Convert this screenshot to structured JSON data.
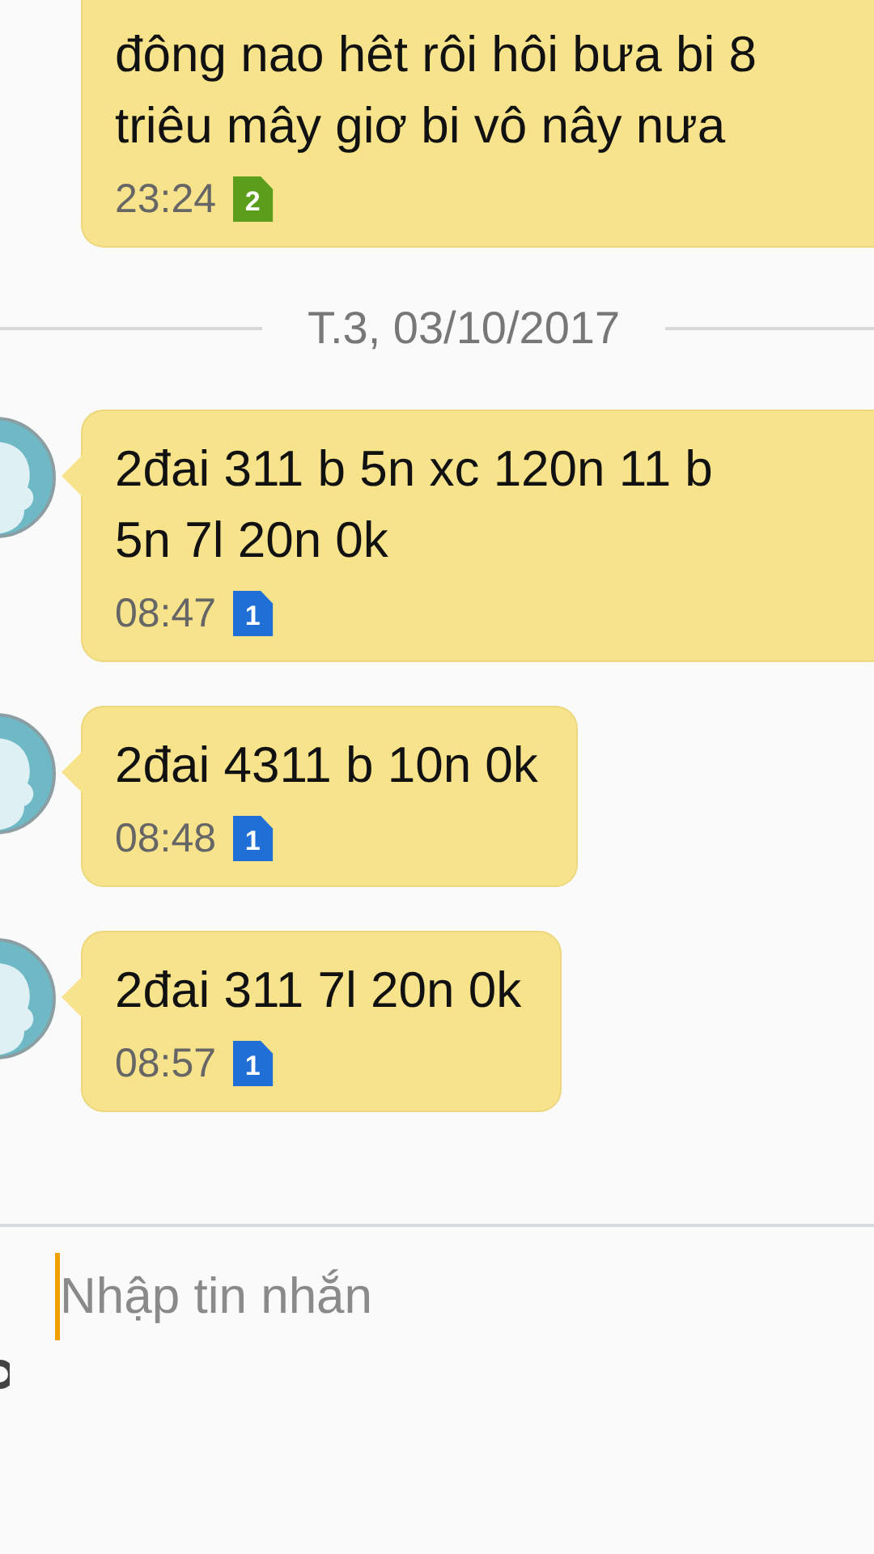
{
  "messages": [
    {
      "text": "đông nao hêt rôi hôi bưa bi 8\ntriêu mây giơ bi vô nây nưa",
      "time": "23:24",
      "sim": "2",
      "color": "#5a9e1c",
      "avatar": false,
      "cut_top": true
    },
    {
      "kind": "date",
      "text": "T.3, 03/10/2017"
    },
    {
      "text": "2đai 311 b 5n xc 120n 11 b\n5n 7l 20n 0k",
      "time": "08:47",
      "sim": "1",
      "color": "#1f6fd6",
      "avatar": true,
      "cut_top": false
    },
    {
      "text": "2đai 4311 b 10n 0k",
      "time": "08:48",
      "sim": "1",
      "color": "#1f6fd6",
      "avatar": true,
      "cut_top": false
    },
    {
      "text": "2đai 311 7l 20n 0k",
      "time": "08:57",
      "sim": "1",
      "color": "#1f6fd6",
      "avatar": true,
      "cut_top": false
    }
  ],
  "composer": {
    "placeholder": "Nhập tin nhắn"
  }
}
